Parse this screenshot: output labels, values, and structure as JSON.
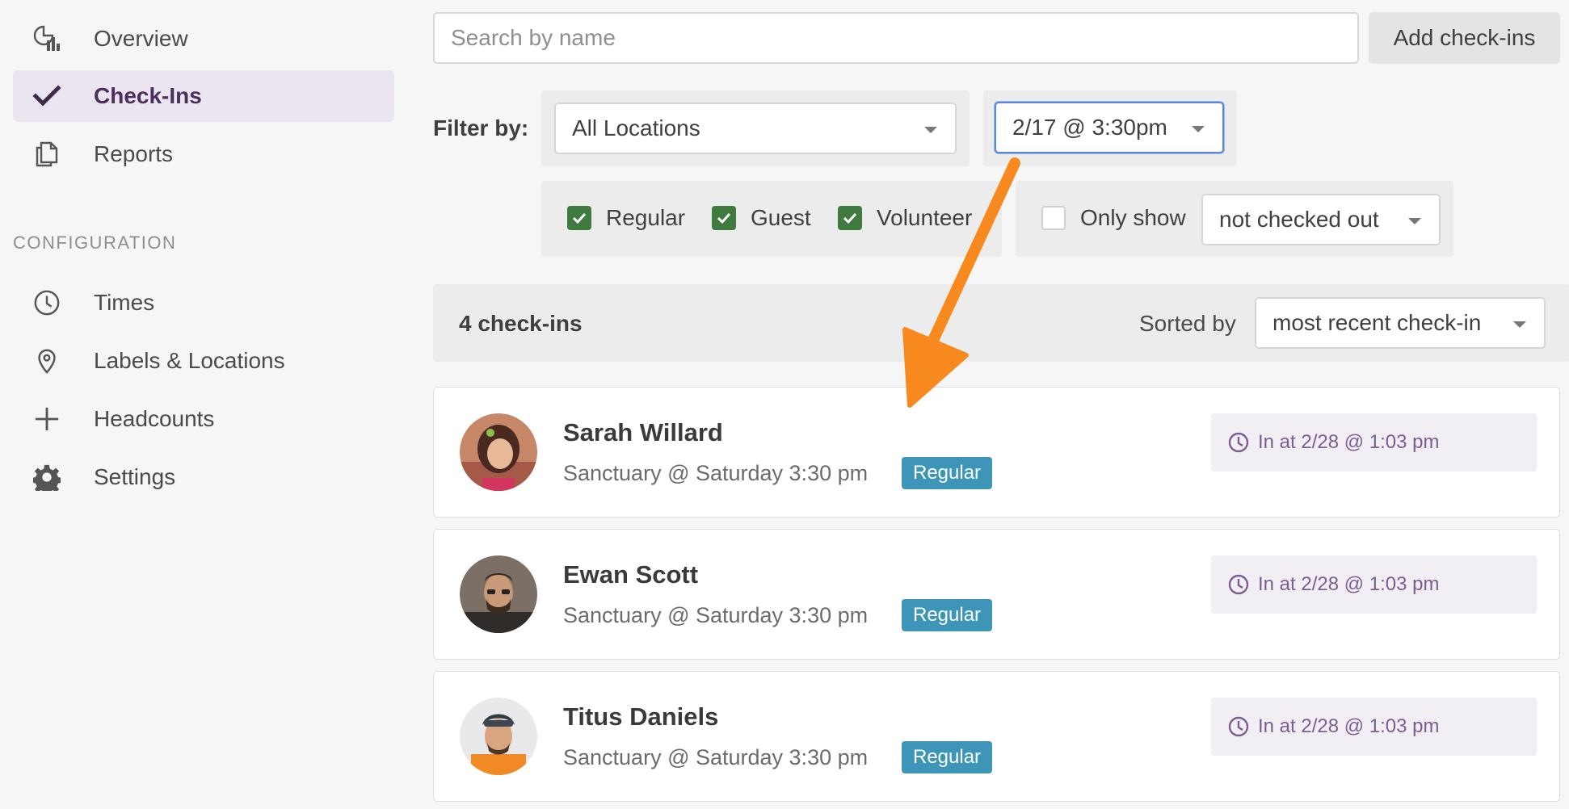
{
  "sidebar": {
    "nav": [
      {
        "label": "Overview",
        "icon": "overview-chart-icon",
        "active": false
      },
      {
        "label": "Check-Ins",
        "icon": "checkmark-icon",
        "active": true
      },
      {
        "label": "Reports",
        "icon": "documents-icon",
        "active": false
      }
    ],
    "config_title": "CONFIGURATION",
    "config": [
      {
        "label": "Times",
        "icon": "clock-icon"
      },
      {
        "label": "Labels & Locations",
        "icon": "location-pin-icon"
      },
      {
        "label": "Headcounts",
        "icon": "plus-icon"
      },
      {
        "label": "Settings",
        "icon": "gear-icon"
      }
    ]
  },
  "search": {
    "placeholder": "Search by name"
  },
  "toolbar": {
    "add_label": "Add check-ins"
  },
  "filters": {
    "label": "Filter by:",
    "location": "All Locations",
    "time": "2/17 @ 3:30pm",
    "kinds": [
      {
        "label": "Regular",
        "checked": true
      },
      {
        "label": "Guest",
        "checked": true
      },
      {
        "label": "Volunteer",
        "checked": true
      }
    ],
    "only_show": {
      "label": "Only show",
      "checked": false,
      "value": "not checked out"
    }
  },
  "results": {
    "count": "4 check-ins",
    "sorted_label": "Sorted by",
    "sort_value": "most recent check-in"
  },
  "checkins": [
    {
      "name": "Sarah Willard",
      "event": "Sanctuary @ Saturday 3:30 pm",
      "kind": "Regular",
      "time": "In at 2/28 @ 1:03 pm"
    },
    {
      "name": "Ewan Scott",
      "event": "Sanctuary @ Saturday 3:30 pm",
      "kind": "Regular",
      "time": "In at 2/28 @ 1:03 pm"
    },
    {
      "name": "Titus Daniels",
      "event": "Sanctuary @ Saturday 3:30 pm",
      "kind": "Regular",
      "time": "In at 2/28 @ 1:03 pm"
    }
  ],
  "colors": {
    "active_nav_bg": "#ebe5ef",
    "active_nav_text": "#4a2f5c",
    "checkbox_green": "#3f7a3f",
    "badge_blue": "#3d96b8",
    "time_text": "#7c5d93",
    "annotation_arrow": "#f7891e"
  }
}
